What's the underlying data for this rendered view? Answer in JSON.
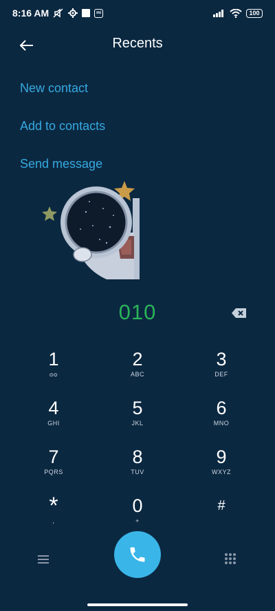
{
  "status_bar": {
    "time": "8:16 AM",
    "left_icons": [
      "mute-icon",
      "settings-gear-icon",
      "square-icon",
      "mi-icon"
    ],
    "right_icons": [
      "signal-icon",
      "wifi-icon"
    ],
    "battery": "100"
  },
  "header": {
    "title": "Recents",
    "back_icon": "back-arrow-icon"
  },
  "actions": [
    {
      "label": "New contact"
    },
    {
      "label": "Add to contacts"
    },
    {
      "label": "Send message"
    }
  ],
  "illustration": "astronaut-with-stars",
  "dialed_number": "010",
  "keypad": [
    [
      {
        "digit": "1",
        "sub": "ᴑᴑ"
      },
      {
        "digit": "2",
        "sub": "ABC"
      },
      {
        "digit": "3",
        "sub": "DEF"
      }
    ],
    [
      {
        "digit": "4",
        "sub": "GHI"
      },
      {
        "digit": "5",
        "sub": "JKL"
      },
      {
        "digit": "6",
        "sub": "MNO"
      }
    ],
    [
      {
        "digit": "7",
        "sub": "PQRS"
      },
      {
        "digit": "8",
        "sub": "TUV"
      },
      {
        "digit": "9",
        "sub": "WXYZ"
      }
    ],
    [
      {
        "digit": "*",
        "sub": ","
      },
      {
        "digit": "0",
        "sub": "+"
      },
      {
        "digit": "#",
        "sub": ""
      }
    ]
  ],
  "colors": {
    "background": "#0b2841",
    "accent_link": "#36a9e0",
    "number_green": "#2bb35a",
    "call_button": "#3ab5e8"
  }
}
